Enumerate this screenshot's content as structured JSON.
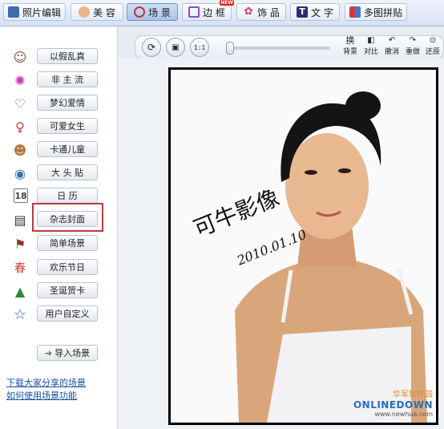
{
  "tabs": [
    {
      "label": "照片编辑",
      "icon": "photo-edit-icon",
      "active": false
    },
    {
      "label": "美 容",
      "icon": "beauty-face-icon",
      "active": false
    },
    {
      "label": "场 景",
      "icon": "scene-icon",
      "active": true
    },
    {
      "label": "边 框",
      "icon": "frame-icon",
      "active": false,
      "badge": "NEW"
    },
    {
      "label": "饰 品",
      "icon": "bow-icon",
      "active": false
    },
    {
      "label": "文 字",
      "icon": "text-icon",
      "active": false
    },
    {
      "label": "多图拼贴",
      "icon": "collage-icon",
      "active": false
    }
  ],
  "sidebar": {
    "items": [
      {
        "label": "以假乱真",
        "icon": "realistic-icon"
      },
      {
        "label": "非 主 流",
        "icon": "nonmainstream-icon"
      },
      {
        "label": "梦幻爱情",
        "icon": "heart-icon"
      },
      {
        "label": "可爱女生",
        "icon": "cute-girl-icon"
      },
      {
        "label": "卡通儿童",
        "icon": "cartoon-kid-icon"
      },
      {
        "label": "大 头 贴",
        "icon": "big-head-icon"
      },
      {
        "label": "日  历",
        "icon": "calendar-icon"
      },
      {
        "label": "杂志封面",
        "icon": "magazine-icon"
      },
      {
        "label": "简单场景",
        "icon": "simple-scene-icon",
        "selected": true
      },
      {
        "label": "欢乐节日",
        "icon": "festival-icon"
      },
      {
        "label": "圣诞贺卡",
        "icon": "christmas-tree-icon"
      },
      {
        "label": "用户自定义",
        "icon": "star-icon"
      }
    ],
    "import_label": "导入场景",
    "links": [
      "下载大家分享的场景",
      "如何使用场景功能"
    ]
  },
  "toolbar": {
    "swap_label": "换",
    "swap_sub": "背景",
    "compare_label": "对比",
    "undo_label": "撤消",
    "redo_label": "重做",
    "reset_label": "还原"
  },
  "photo": {
    "signature": "可牛影像",
    "date": "2010.01.10"
  },
  "watermark": {
    "line1": "华军软件园",
    "line2": "ONLINEDOWN",
    "line3": "www.newhua.com"
  }
}
